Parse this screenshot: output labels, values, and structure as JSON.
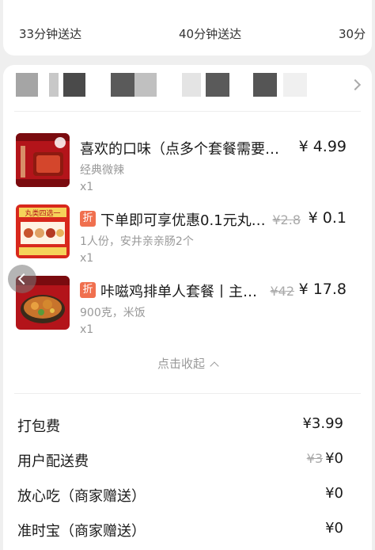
{
  "delivery_options": [
    "33分钟送达",
    "40分钟送达",
    "30分"
  ],
  "items": [
    {
      "name": "喜欢的口味（点多个套餐需要…",
      "spec": "经典微辣",
      "qty": "x1",
      "price": "¥ 4.99",
      "old_price": "",
      "discount": "",
      "thumb_icon": "red-food-package-thumbnail"
    },
    {
      "name": "下单即可享优惠0.1元丸…",
      "spec": "1人份，安井亲亲肠2个",
      "qty": "x1",
      "price": "¥ 0.1",
      "old_price": "¥2.8",
      "discount": "折",
      "thumb_text": "丸类四选一",
      "thumb_icon": "meatball-promo-thumbnail"
    },
    {
      "name": "咔嗞鸡排单人套餐丨主…",
      "spec": "900克，米饭",
      "qty": "x1",
      "price": "¥ 17.8",
      "old_price": "¥42",
      "discount": "折",
      "thumb_icon": "chicken-dish-thumbnail"
    }
  ],
  "collapse_label": "点击收起",
  "fees": [
    {
      "label": "打包费",
      "value": "¥3.99",
      "old_value": ""
    },
    {
      "label": "用户配送费",
      "value": "¥0",
      "old_value": "¥3"
    },
    {
      "label": "放心吃（商家赠送）",
      "value": "¥0",
      "old_value": ""
    },
    {
      "label": "准时宝（商家赠送）",
      "value": "¥0",
      "old_value": ""
    }
  ],
  "colors": {
    "discount_tag": "#f0704f",
    "thumb_red": "#b3141a"
  }
}
